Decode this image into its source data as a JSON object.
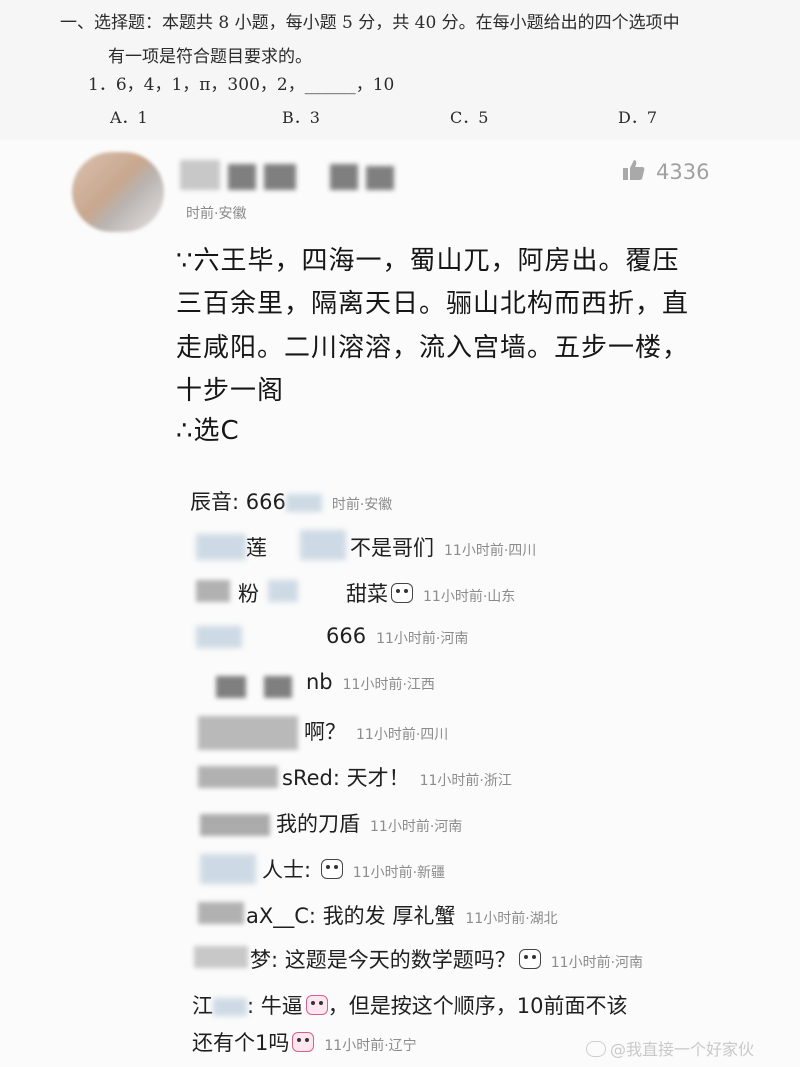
{
  "exam": {
    "instruction_line1": "一、选择题：本题共 8 小题，每小题 5 分，共 40 分。在每小题给出的四个选项中",
    "instruction_line2": "有一项是符合题目要求的。",
    "question": "1．6，4，1，π，300，2，______，10",
    "options": [
      "A．1",
      "B．3",
      "C．5",
      "D．7"
    ]
  },
  "comment": {
    "time_location": "时前·安徽",
    "likes": "4336",
    "lines": [
      "∵六王毕，四海一，蜀山兀，阿房出。覆压",
      "三百余里，隔离天日。骊山北构而西折，直",
      "走咸阳。二川溶溶，流入宫墙。五步一楼，",
      "十步一阁",
      "∴选C"
    ]
  },
  "replies": [
    {
      "name": "辰音: 666",
      "text": "",
      "meta": "时前·安徽"
    },
    {
      "name": "莲",
      "text": "不是哥们",
      "meta": "11小时前·四川"
    },
    {
      "name": "粉",
      "text": "甜菜",
      "meta": "11小时前·山东"
    },
    {
      "name": "",
      "text": "666",
      "meta": "11小时前·河南"
    },
    {
      "name": "",
      "text": "nb",
      "meta": "11小时前·江西"
    },
    {
      "name": "",
      "text": "啊？",
      "meta": "11小时前·四川"
    },
    {
      "name": "sRed:",
      "text": "天才！",
      "meta": "11小时前·浙江"
    },
    {
      "name": "",
      "text": "我的刀盾",
      "meta": "11小时前·河南"
    },
    {
      "name": "人士:",
      "text": "",
      "meta": "11小时前·新疆"
    },
    {
      "name": "aX__C:",
      "text": "我的发 厚礼蟹",
      "meta": "11小时前·湖北"
    },
    {
      "name": "梦:",
      "text": "这题是今天的数学题吗？",
      "meta": "11小时前·河南"
    },
    {
      "name": "江",
      "text": ": 牛逼",
      "text2": "，但是按这个顺序，10前面不该",
      "meta": ""
    },
    {
      "name": "",
      "text": "还有个1吗",
      "meta": "11小时前·辽宁"
    }
  ],
  "watermark": "@我直接一个好家伙",
  "colors": {
    "like_icon": "#a9a9a9",
    "meta_gray": "#8c8c8c",
    "emoji_pink": "#d6608e"
  }
}
